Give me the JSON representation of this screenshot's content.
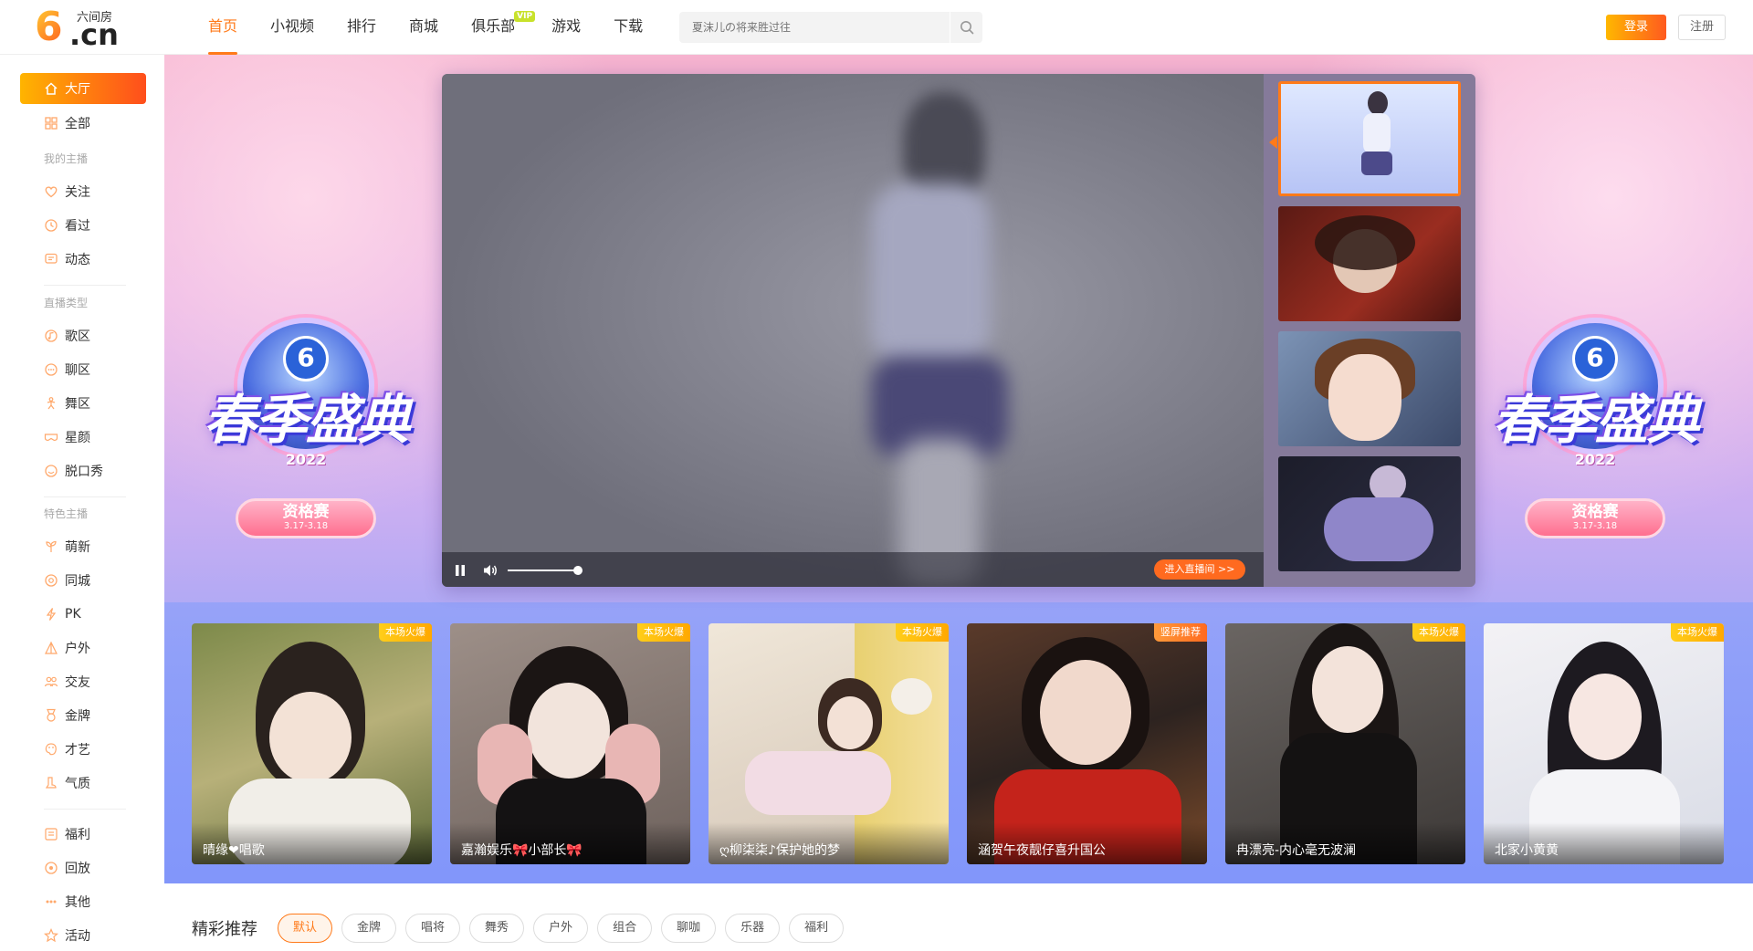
{
  "header": {
    "logo_mark": "6",
    "logo_suffix": ".cn",
    "logo_brand": "六间房",
    "nav": [
      {
        "label": "首页",
        "active": true
      },
      {
        "label": "小视频"
      },
      {
        "label": "排行"
      },
      {
        "label": "商城"
      },
      {
        "label": "俱乐部",
        "tag": "VIP"
      },
      {
        "label": "游戏"
      },
      {
        "label": "下载"
      }
    ],
    "search_placeholder": "夏沫儿の将来胜过往",
    "login_label": "登录",
    "register_label": "注册"
  },
  "sidebar": {
    "hall": "大厅",
    "all": "全部",
    "my_anchor_head": "我的主播",
    "follow": "关注",
    "watched": "看过",
    "dynamic": "动态",
    "live_type_head": "直播类型",
    "song": "歌区",
    "chat": "聊区",
    "dance": "舞区",
    "star": "星颜",
    "talkshow": "脱口秀",
    "feature_head": "特色主播",
    "cute": "萌新",
    "city": "同城",
    "pk": "PK",
    "outdoor": "户外",
    "friends": "交友",
    "gold": "金牌",
    "talent": "才艺",
    "temperament": "气质",
    "welfare": "福利",
    "replay": "回放",
    "other": "其他",
    "activity": "活动"
  },
  "banner": {
    "event_title": "春季盛典",
    "event_mark": "6",
    "event_year": "2022",
    "event_stage": "资格赛",
    "event_dates": "3.17-3.18",
    "enter_room": "进入直播间 >>",
    "cards": [
      {
        "name": "晴缘❤唱歌",
        "badge": "本场火爆"
      },
      {
        "name": "嘉瀚娱乐🎀小部长🎀",
        "badge": "本场火爆"
      },
      {
        "name": "ღ柳柒柒♪保护她的梦",
        "badge": "本场火爆"
      },
      {
        "name": "涵贺午夜靓仔喜升国公",
        "badge": "竖屏推荐"
      },
      {
        "name": "冉漂亮-内心毫无波澜",
        "badge": "本场火爆"
      },
      {
        "name": "北家小黄黄",
        "badge": "本场火爆"
      }
    ]
  },
  "recommend": {
    "title": "精彩推荐",
    "tabs": [
      "默认",
      "金牌",
      "唱将",
      "舞秀",
      "户外",
      "组合",
      "聊咖",
      "乐器",
      "福利"
    ]
  },
  "colors": {
    "accent": "#ff7a1a",
    "login_gradient_start": "#ffb700",
    "login_gradient_end": "#ff5a1f"
  }
}
